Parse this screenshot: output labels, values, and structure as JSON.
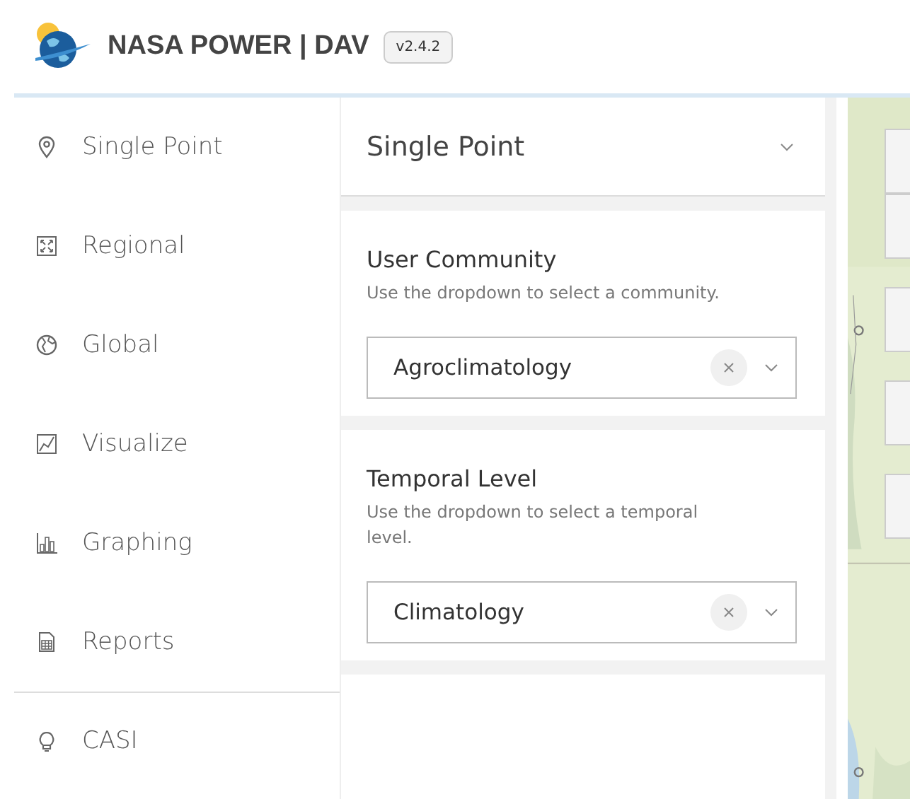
{
  "header": {
    "title": "NASA POWER | DAV",
    "version": "v2.4.2"
  },
  "sidebar": {
    "items": [
      {
        "label": "Single Point"
      },
      {
        "label": "Regional"
      },
      {
        "label": "Global"
      },
      {
        "label": "Visualize"
      },
      {
        "label": "Graphing"
      },
      {
        "label": "Reports"
      }
    ],
    "footer_items": [
      {
        "label": "CASI"
      }
    ]
  },
  "panel": {
    "title": "Single Point",
    "sections": [
      {
        "title": "User Community",
        "description": "Use the dropdown to select a community.",
        "value": "Agroclimatology"
      },
      {
        "title": "Temporal Level",
        "description": "Use the dropdown to select a temporal level.",
        "value": "Climatology"
      }
    ]
  }
}
